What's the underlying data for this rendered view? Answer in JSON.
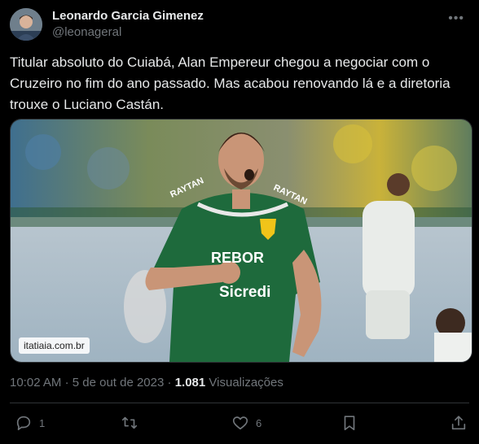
{
  "author": {
    "name": "Leonardo Garcia Gimenez",
    "handle": "@leonageral"
  },
  "tweet": {
    "text": "Titular absoluto do Cuiabá, Alan Empereur chegou a negociar com o Cruzeiro no fim do ano passado. Mas acabou renovando lá e a diretoria trouxe o Luciano Castán."
  },
  "media": {
    "watermark": "itatiaia.com.br",
    "jersey_lines": [
      "RAYTAN",
      "REBOR",
      "Sicredi"
    ]
  },
  "meta": {
    "time": "10:02 AM",
    "separator": "·",
    "date": "5 de out de 2023",
    "views_count": "1.081",
    "views_label": "Visualizações"
  },
  "actions": {
    "replies": "1",
    "likes": "6"
  },
  "icons": [
    "more-icon",
    "reply-icon",
    "retweet-icon",
    "like-icon",
    "bookmark-icon",
    "share-icon"
  ],
  "colors": {
    "background": "#000000",
    "text": "#e7e9ea",
    "muted": "#71767b",
    "border": "#2f3336",
    "jersey_green": "#1e6a3c"
  }
}
